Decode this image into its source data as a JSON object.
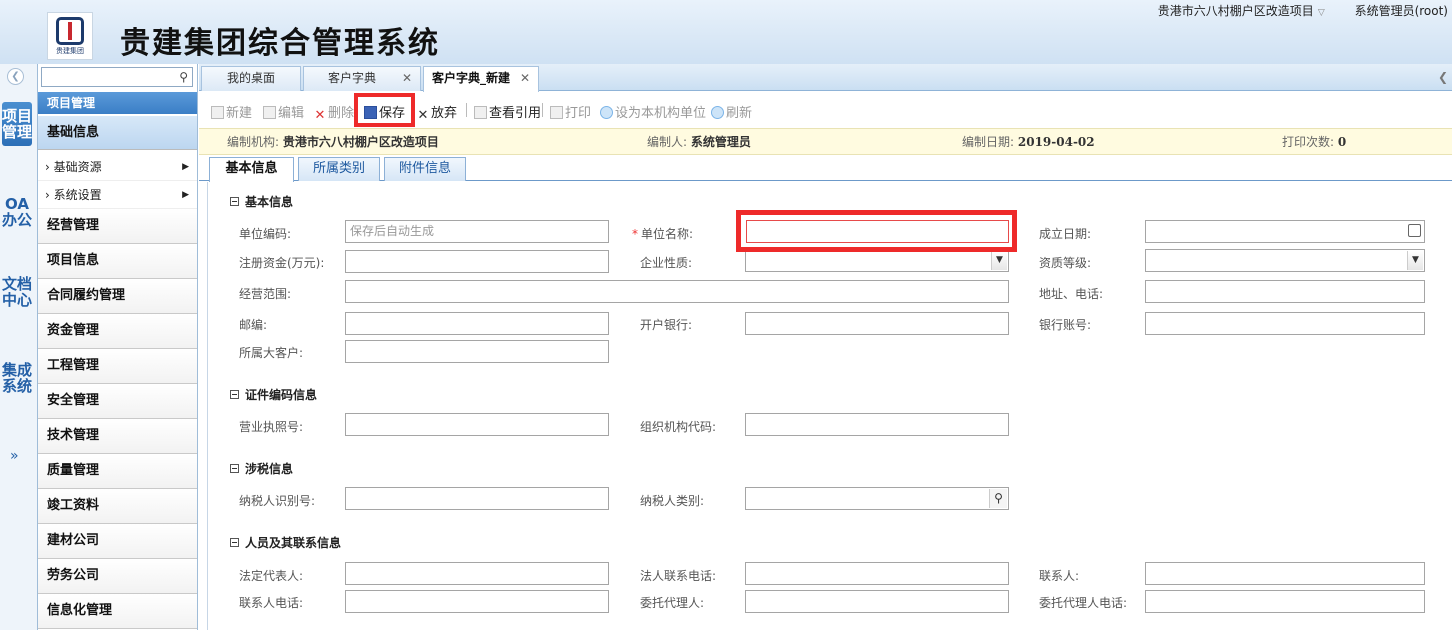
{
  "header": {
    "system_title": "贵建集团综合管理系统",
    "logo_text": "贵建集团",
    "project_selector": "贵港市六八村棚户区改造项目",
    "user": "系统管理员(root)"
  },
  "left_strip": {
    "tabs": [
      "项目管理",
      "OA办公",
      "文档中心",
      "集成系统"
    ],
    "more": "»"
  },
  "sidebar": {
    "section_title": "项目管理",
    "active_item": "基础信息",
    "subitems": [
      "基础资源",
      "系统设置"
    ],
    "items": [
      "经营管理",
      "项目信息",
      "合同履约管理",
      "资金管理",
      "工程管理",
      "安全管理",
      "技术管理",
      "质量管理",
      "竣工资料",
      "建材公司",
      "劳务公司",
      "信息化管理"
    ]
  },
  "page_tabs": [
    {
      "label": "我的桌面"
    },
    {
      "label": "客户字典"
    },
    {
      "label": "客户字典_新建"
    }
  ],
  "toolbar": {
    "new": "新建",
    "edit": "编辑",
    "delete": "删除",
    "save": "保存",
    "discard": "放弃",
    "view_refs": "查看引用",
    "print": "打印",
    "set_org": "设为本机构单位",
    "refresh": "刷新"
  },
  "infobar": {
    "org_label": "编制机构:",
    "org_value": "贵港市六八村棚户区改造项目",
    "author_label": "编制人:",
    "author_value": "系统管理员",
    "date_label": "编制日期:",
    "date_value": "2019-04-02",
    "print_label": "打印次数:",
    "print_value": "0"
  },
  "form_tabs": [
    "基本信息",
    "所属类别",
    "附件信息"
  ],
  "sections": {
    "basic": "基本信息",
    "cert": "证件编码信息",
    "tax": "涉税信息",
    "contacts": "人员及其联系信息"
  },
  "fields": {
    "unit_code": {
      "label": "单位编码:",
      "placeholder": "保存后自动生成"
    },
    "unit_name": {
      "label": "单位名称:",
      "required": "*"
    },
    "founded_date": {
      "label": "成立日期:"
    },
    "reg_capital": {
      "label": "注册资金(万元):"
    },
    "enterprise_type": {
      "label": "企业性质:"
    },
    "qualification": {
      "label": "资质等级:"
    },
    "business_scope": {
      "label": "经营范围:"
    },
    "address_phone": {
      "label": "地址、电话:"
    },
    "postcode": {
      "label": "邮编:"
    },
    "bank": {
      "label": "开户银行:"
    },
    "bank_account": {
      "label": "银行账号:"
    },
    "parent_client": {
      "label": "所属大客户:"
    },
    "license_no": {
      "label": "营业执照号:"
    },
    "org_code": {
      "label": "组织机构代码:"
    },
    "taxpayer_id": {
      "label": "纳税人识别号:"
    },
    "taxpayer_type": {
      "label": "纳税人类别:"
    },
    "legal_rep": {
      "label": "法定代表人:"
    },
    "legal_phone": {
      "label": "法人联系电话:"
    },
    "contact": {
      "label": "联系人:"
    },
    "contact_phone": {
      "label": "联系人电话:"
    },
    "agent": {
      "label": "委托代理人:"
    },
    "agent_phone": {
      "label": "委托代理人电话:"
    }
  },
  "colors": {
    "highlight": "#ee2a2a",
    "accent": "#3a7ec6"
  }
}
